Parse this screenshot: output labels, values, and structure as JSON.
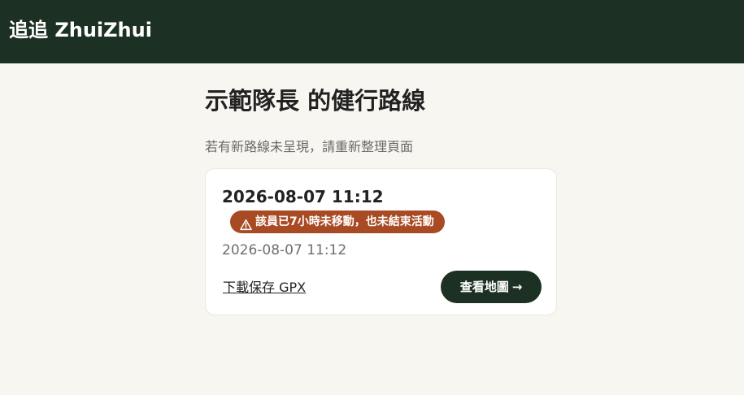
{
  "header": {
    "brand": "追追 ZhuiZhui"
  },
  "page": {
    "title": "示範隊長 的健行路線",
    "hint": "若有新路線未呈現，請重新整理頁面"
  },
  "routes": [
    {
      "title": "2026-08-07 11:12",
      "alert": {
        "icon": "warning-triangle-icon",
        "text": "該員已7小時未移動，也未結束活動"
      },
      "time": "2026-08-07 11:12",
      "download_label": "下載保存 GPX",
      "map_button": {
        "label": "查看地圖",
        "arrow": "→"
      }
    }
  ],
  "colors": {
    "header_bg": "#1c3124",
    "page_bg": "#f8f6f1",
    "alert_bg": "#a84a23",
    "button_bg": "#1c3124"
  }
}
